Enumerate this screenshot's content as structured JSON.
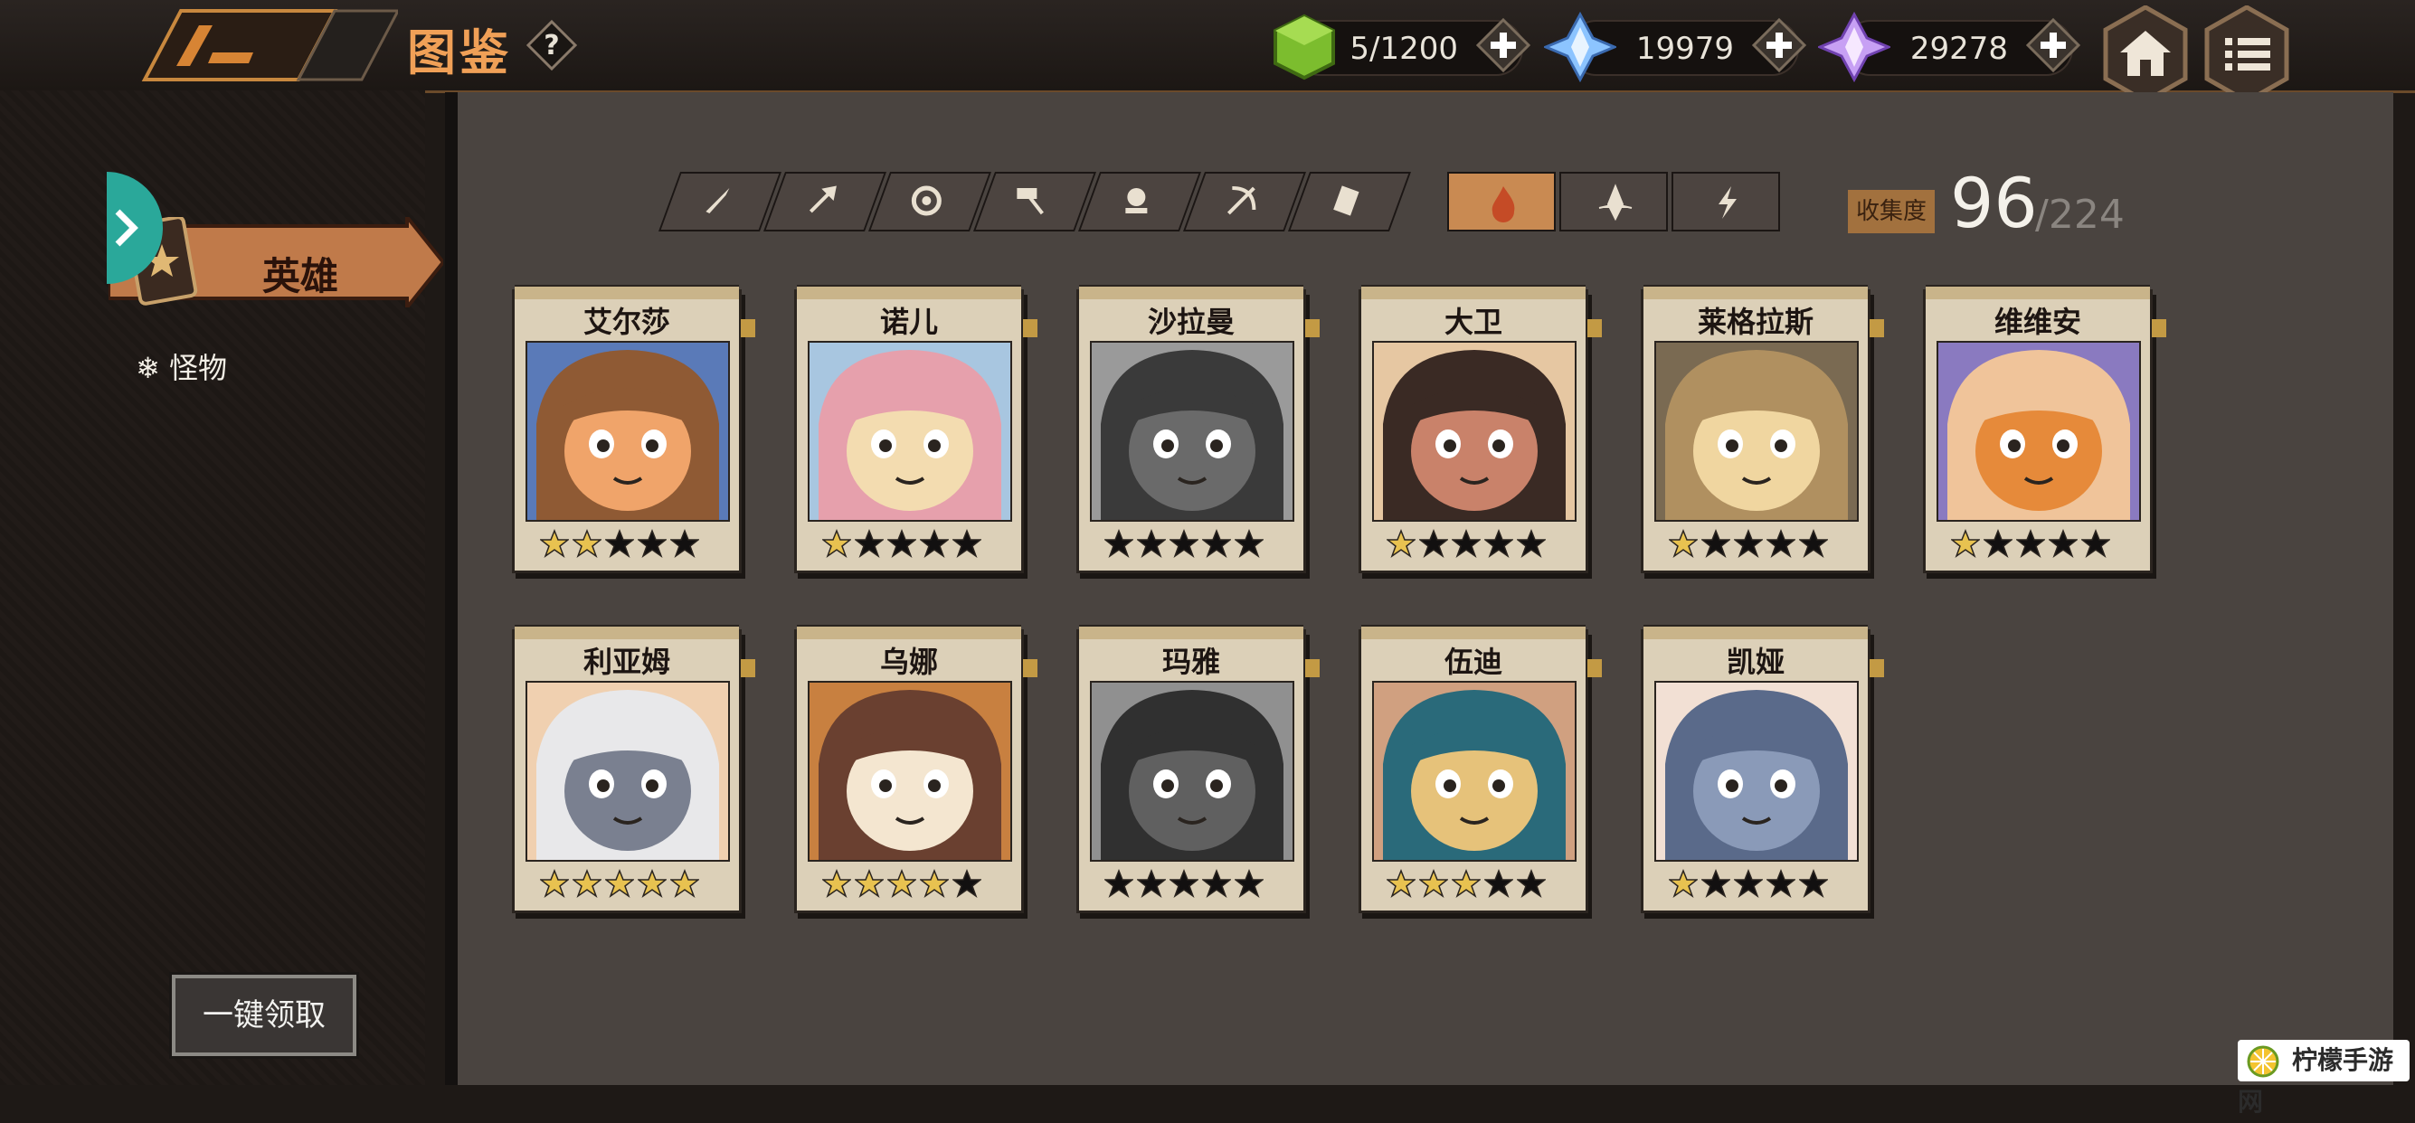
{
  "header": {
    "title": "图鉴",
    "resources": [
      {
        "name": "energy-cube",
        "value": "5/1200",
        "color": "#8ecf3a"
      },
      {
        "name": "blue-crystal",
        "value": "19979",
        "color": "#7fb8ff"
      },
      {
        "name": "purple-crystal",
        "value": "29278",
        "color": "#c49cf0"
      }
    ]
  },
  "sidebar": {
    "hero_tab": "英雄",
    "monster_item": "怪物",
    "claim_all": "一键领取"
  },
  "collection": {
    "label": "收集度",
    "count": "96",
    "total": "/224"
  },
  "heroes": [
    {
      "name": "艾尔莎",
      "stars": 2,
      "colors": [
        "#8f5a34",
        "#f0a46a",
        "#5a7ab8"
      ]
    },
    {
      "name": "诺儿",
      "stars": 1,
      "colors": [
        "#e6a0ac",
        "#f3dcb0",
        "#a8c6e0"
      ]
    },
    {
      "name": "沙拉曼",
      "stars": 0,
      "colors": [
        "#3a3a3a",
        "#6a6a6a",
        "#9a9a9a"
      ]
    },
    {
      "name": "大卫",
      "stars": 1,
      "colors": [
        "#3a2a24",
        "#c9826a",
        "#e6c7a2"
      ]
    },
    {
      "name": "莱格拉斯",
      "stars": 1,
      "colors": [
        "#b09060",
        "#f0d6a0",
        "#7a6a52"
      ]
    },
    {
      "name": "维维安",
      "stars": 1,
      "colors": [
        "#f0c49a",
        "#e68a3a",
        "#8a7ac0"
      ]
    },
    {
      "name": "利亚姆",
      "stars": 5,
      "colors": [
        "#e8e8ea",
        "#7a8090",
        "#f0d0b0"
      ]
    },
    {
      "name": "乌娜",
      "stars": 4,
      "colors": [
        "#6a4030",
        "#f4e6d0",
        "#c88040"
      ]
    },
    {
      "name": "玛雅",
      "stars": 0,
      "colors": [
        "#303030",
        "#606060",
        "#909090"
      ]
    },
    {
      "name": "伍迪",
      "stars": 3,
      "colors": [
        "#2a6a7a",
        "#e6c27a",
        "#d0a080"
      ]
    },
    {
      "name": "凯娅",
      "stars": 1,
      "colors": [
        "#5a6a8a",
        "#8a9ab8",
        "#f2e0d4"
      ]
    }
  ],
  "watermark": "柠檬手游网"
}
